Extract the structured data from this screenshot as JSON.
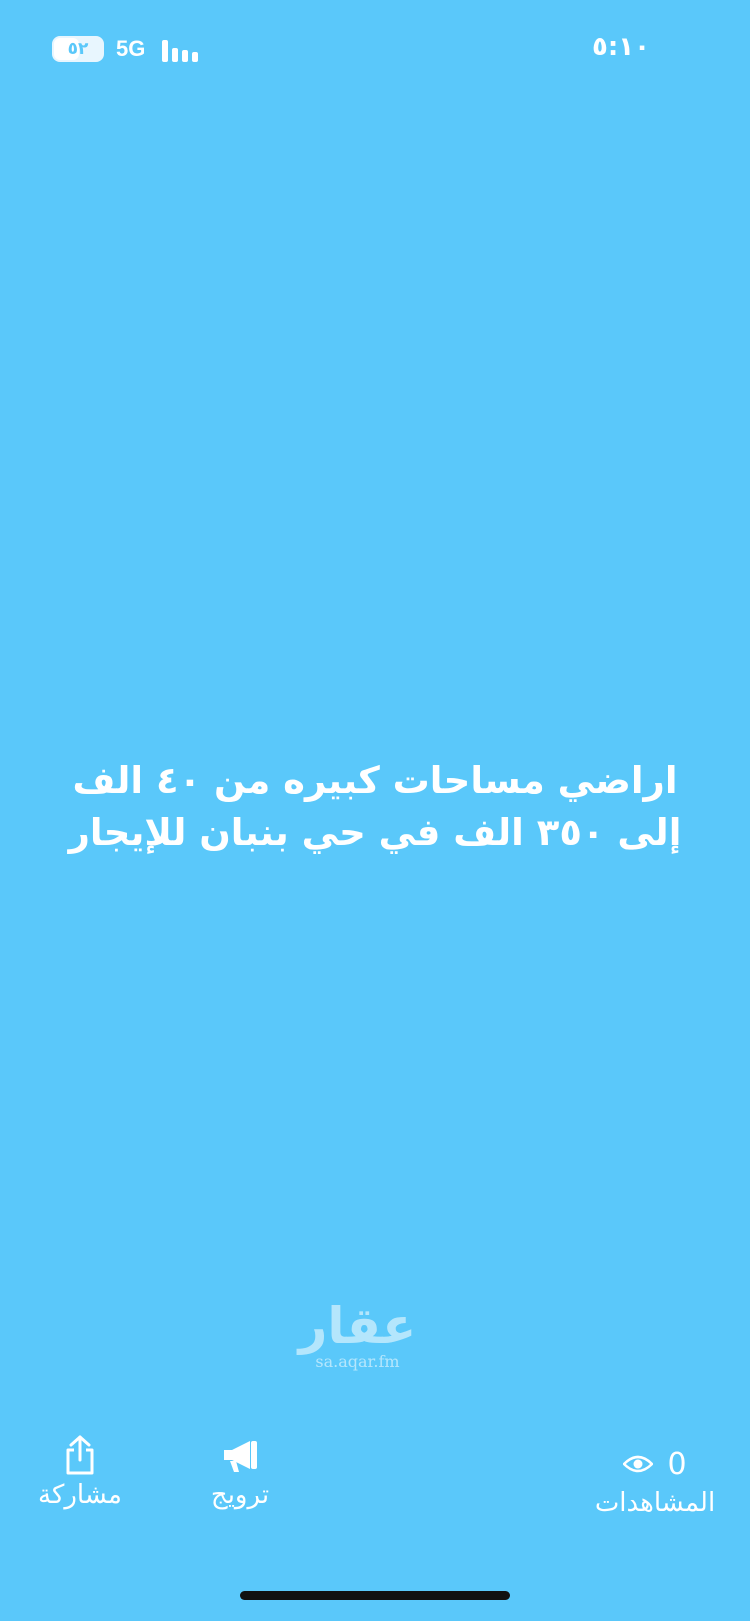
{
  "status_bar": {
    "battery_level": "٥٢",
    "battery_fraction": 0.52,
    "network": "5G",
    "time": "٥:١٠"
  },
  "post": {
    "text": "اراضي مساحات كبيره من ٤٠ الف  إلى ٣٥٠ الف في حي بنبان للإيجار"
  },
  "watermark": {
    "logo": "عقار",
    "url": "sa.aqar.fm"
  },
  "actions": {
    "share_label": "مشاركة",
    "promote_label": "ترويج",
    "views_label": "المشاهدات",
    "views_count": "0"
  },
  "colors": {
    "background": "#5ac8fa",
    "text": "#ffffff"
  },
  "icons": {
    "share": "share-icon",
    "promote": "megaphone-icon",
    "views": "eye-icon"
  }
}
